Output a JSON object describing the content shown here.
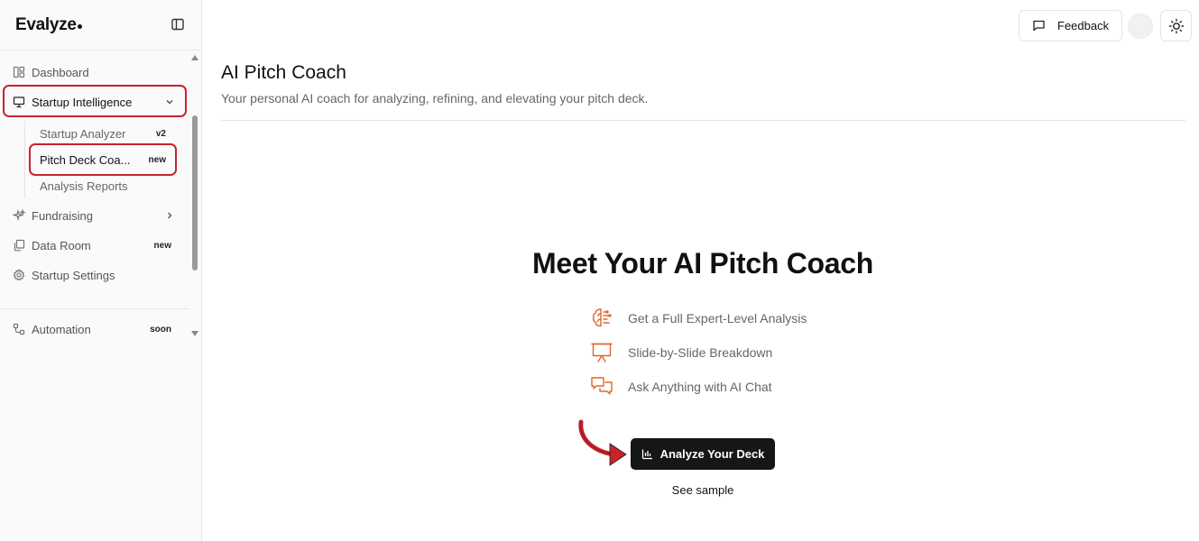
{
  "brand": {
    "name": "Evalyze"
  },
  "sidebar": {
    "items": [
      {
        "label": "Dashboard",
        "icon": "dashboard-icon"
      },
      {
        "label": "Startup Intelligence",
        "icon": "presentation-icon",
        "expanded": true
      },
      {
        "label": "Fundraising",
        "icon": "sparkles-icon"
      },
      {
        "label": "Data Room",
        "icon": "files-icon",
        "badge": "new"
      },
      {
        "label": "Startup Settings",
        "icon": "gear-icon"
      },
      {
        "label": "Automation",
        "icon": "workflow-icon",
        "badge": "soon"
      }
    ],
    "subitems": [
      {
        "label": "Startup Analyzer",
        "badge": "v2"
      },
      {
        "label": "Pitch Deck Coa...",
        "badge": "new",
        "active": true
      },
      {
        "label": "Analysis Reports"
      }
    ]
  },
  "header": {
    "feedback_label": "Feedback"
  },
  "page": {
    "title": "AI Pitch Coach",
    "subtitle": "Your personal AI coach for analyzing, refining, and elevating your pitch deck."
  },
  "hero": {
    "title": "Meet Your AI Pitch Coach",
    "features": [
      {
        "label": "Get a Full Expert-Level Analysis",
        "icon": "brain-icon"
      },
      {
        "label": "Slide-by-Slide Breakdown",
        "icon": "presentation-board-icon"
      },
      {
        "label": "Ask Anything with AI Chat",
        "icon": "chat-bubbles-icon"
      }
    ],
    "cta_label": "Analyze Your Deck",
    "sample_label": "See sample"
  },
  "colors": {
    "accent_icon": "#e0662a",
    "highlight": "#c8232c",
    "cta_bg": "#161616"
  }
}
